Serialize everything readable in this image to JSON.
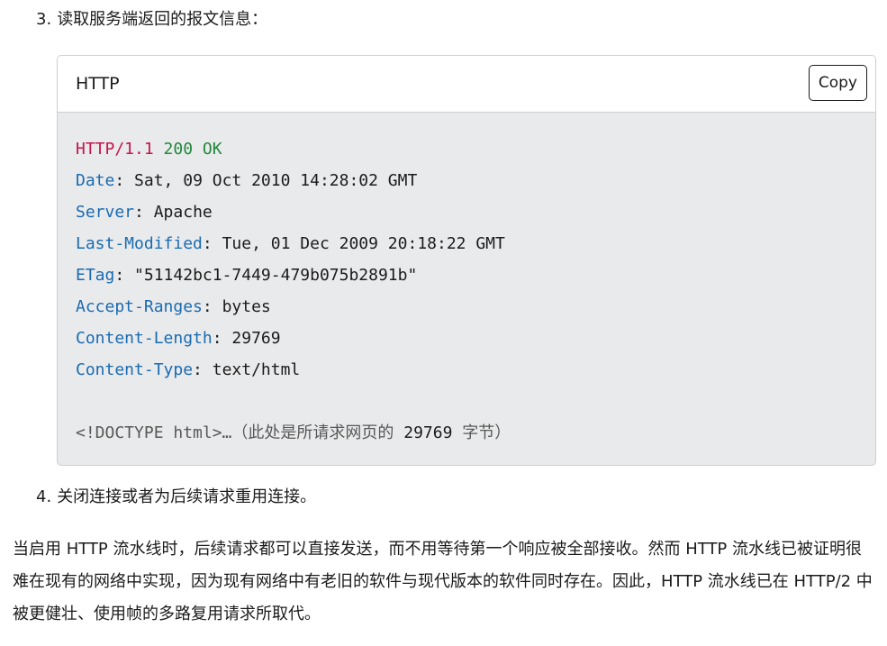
{
  "step3": {
    "number": "3.",
    "text": "读取服务端返回的报文信息："
  },
  "code_block": {
    "language": "HTTP",
    "copy_label": "Copy",
    "status_line": {
      "protocol": "HTTP/1.1",
      "status": "200 OK"
    },
    "headers": [
      {
        "name": "Date",
        "value": "Sat, 09 Oct 2010 14:28:02 GMT"
      },
      {
        "name": "Server",
        "value": "Apache"
      },
      {
        "name": "Last-Modified",
        "value": "Tue, 01 Dec 2009 20:18:22 GMT"
      },
      {
        "name": "ETag",
        "value": "\"51142bc1-7449-479b075b2891b\""
      },
      {
        "name": "Accept-Ranges",
        "value": "bytes"
      },
      {
        "name": "Content-Length",
        "value": "29769"
      },
      {
        "name": "Content-Type",
        "value": "text/html"
      }
    ],
    "body_line": {
      "prefix": "<!DOCTYPE html>…（此处是所请求网页的 ",
      "number": "29769",
      "suffix": " 字节）"
    }
  },
  "step4": {
    "number": "4.",
    "text": "关闭连接或者为后续请求重用连接。"
  },
  "paragraph": "当启用 HTTP 流水线时，后续请求都可以直接发送，而不用等待第一个响应被全部接收。然而 HTTP 流水线已被证明很难在现有的网络中实现，因为现有网络中有老旧的软件与现代版本的软件同时存在。因此，HTTP 流水线已在 HTTP/2 中被更健壮、使用帧的多路复用请求所取代。"
}
